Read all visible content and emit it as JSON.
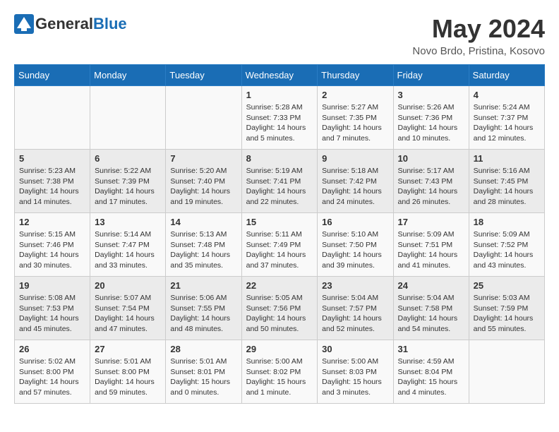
{
  "header": {
    "logo_text_general": "General",
    "logo_text_blue": "Blue",
    "month_title": "May 2024",
    "location": "Novo Brdo, Pristina, Kosovo"
  },
  "calendar": {
    "days_of_week": [
      "Sunday",
      "Monday",
      "Tuesday",
      "Wednesday",
      "Thursday",
      "Friday",
      "Saturday"
    ],
    "weeks": [
      [
        {
          "day": "",
          "info": ""
        },
        {
          "day": "",
          "info": ""
        },
        {
          "day": "",
          "info": ""
        },
        {
          "day": "1",
          "info": "Sunrise: 5:28 AM\nSunset: 7:33 PM\nDaylight: 14 hours\nand 5 minutes."
        },
        {
          "day": "2",
          "info": "Sunrise: 5:27 AM\nSunset: 7:35 PM\nDaylight: 14 hours\nand 7 minutes."
        },
        {
          "day": "3",
          "info": "Sunrise: 5:26 AM\nSunset: 7:36 PM\nDaylight: 14 hours\nand 10 minutes."
        },
        {
          "day": "4",
          "info": "Sunrise: 5:24 AM\nSunset: 7:37 PM\nDaylight: 14 hours\nand 12 minutes."
        }
      ],
      [
        {
          "day": "5",
          "info": "Sunrise: 5:23 AM\nSunset: 7:38 PM\nDaylight: 14 hours\nand 14 minutes."
        },
        {
          "day": "6",
          "info": "Sunrise: 5:22 AM\nSunset: 7:39 PM\nDaylight: 14 hours\nand 17 minutes."
        },
        {
          "day": "7",
          "info": "Sunrise: 5:20 AM\nSunset: 7:40 PM\nDaylight: 14 hours\nand 19 minutes."
        },
        {
          "day": "8",
          "info": "Sunrise: 5:19 AM\nSunset: 7:41 PM\nDaylight: 14 hours\nand 22 minutes."
        },
        {
          "day": "9",
          "info": "Sunrise: 5:18 AM\nSunset: 7:42 PM\nDaylight: 14 hours\nand 24 minutes."
        },
        {
          "day": "10",
          "info": "Sunrise: 5:17 AM\nSunset: 7:43 PM\nDaylight: 14 hours\nand 26 minutes."
        },
        {
          "day": "11",
          "info": "Sunrise: 5:16 AM\nSunset: 7:45 PM\nDaylight: 14 hours\nand 28 minutes."
        }
      ],
      [
        {
          "day": "12",
          "info": "Sunrise: 5:15 AM\nSunset: 7:46 PM\nDaylight: 14 hours\nand 30 minutes."
        },
        {
          "day": "13",
          "info": "Sunrise: 5:14 AM\nSunset: 7:47 PM\nDaylight: 14 hours\nand 33 minutes."
        },
        {
          "day": "14",
          "info": "Sunrise: 5:13 AM\nSunset: 7:48 PM\nDaylight: 14 hours\nand 35 minutes."
        },
        {
          "day": "15",
          "info": "Sunrise: 5:11 AM\nSunset: 7:49 PM\nDaylight: 14 hours\nand 37 minutes."
        },
        {
          "day": "16",
          "info": "Sunrise: 5:10 AM\nSunset: 7:50 PM\nDaylight: 14 hours\nand 39 minutes."
        },
        {
          "day": "17",
          "info": "Sunrise: 5:09 AM\nSunset: 7:51 PM\nDaylight: 14 hours\nand 41 minutes."
        },
        {
          "day": "18",
          "info": "Sunrise: 5:09 AM\nSunset: 7:52 PM\nDaylight: 14 hours\nand 43 minutes."
        }
      ],
      [
        {
          "day": "19",
          "info": "Sunrise: 5:08 AM\nSunset: 7:53 PM\nDaylight: 14 hours\nand 45 minutes."
        },
        {
          "day": "20",
          "info": "Sunrise: 5:07 AM\nSunset: 7:54 PM\nDaylight: 14 hours\nand 47 minutes."
        },
        {
          "day": "21",
          "info": "Sunrise: 5:06 AM\nSunset: 7:55 PM\nDaylight: 14 hours\nand 48 minutes."
        },
        {
          "day": "22",
          "info": "Sunrise: 5:05 AM\nSunset: 7:56 PM\nDaylight: 14 hours\nand 50 minutes."
        },
        {
          "day": "23",
          "info": "Sunrise: 5:04 AM\nSunset: 7:57 PM\nDaylight: 14 hours\nand 52 minutes."
        },
        {
          "day": "24",
          "info": "Sunrise: 5:04 AM\nSunset: 7:58 PM\nDaylight: 14 hours\nand 54 minutes."
        },
        {
          "day": "25",
          "info": "Sunrise: 5:03 AM\nSunset: 7:59 PM\nDaylight: 14 hours\nand 55 minutes."
        }
      ],
      [
        {
          "day": "26",
          "info": "Sunrise: 5:02 AM\nSunset: 8:00 PM\nDaylight: 14 hours\nand 57 minutes."
        },
        {
          "day": "27",
          "info": "Sunrise: 5:01 AM\nSunset: 8:00 PM\nDaylight: 14 hours\nand 59 minutes."
        },
        {
          "day": "28",
          "info": "Sunrise: 5:01 AM\nSunset: 8:01 PM\nDaylight: 15 hours\nand 0 minutes."
        },
        {
          "day": "29",
          "info": "Sunrise: 5:00 AM\nSunset: 8:02 PM\nDaylight: 15 hours\nand 1 minute."
        },
        {
          "day": "30",
          "info": "Sunrise: 5:00 AM\nSunset: 8:03 PM\nDaylight: 15 hours\nand 3 minutes."
        },
        {
          "day": "31",
          "info": "Sunrise: 4:59 AM\nSunset: 8:04 PM\nDaylight: 15 hours\nand 4 minutes."
        },
        {
          "day": "",
          "info": ""
        }
      ]
    ]
  }
}
